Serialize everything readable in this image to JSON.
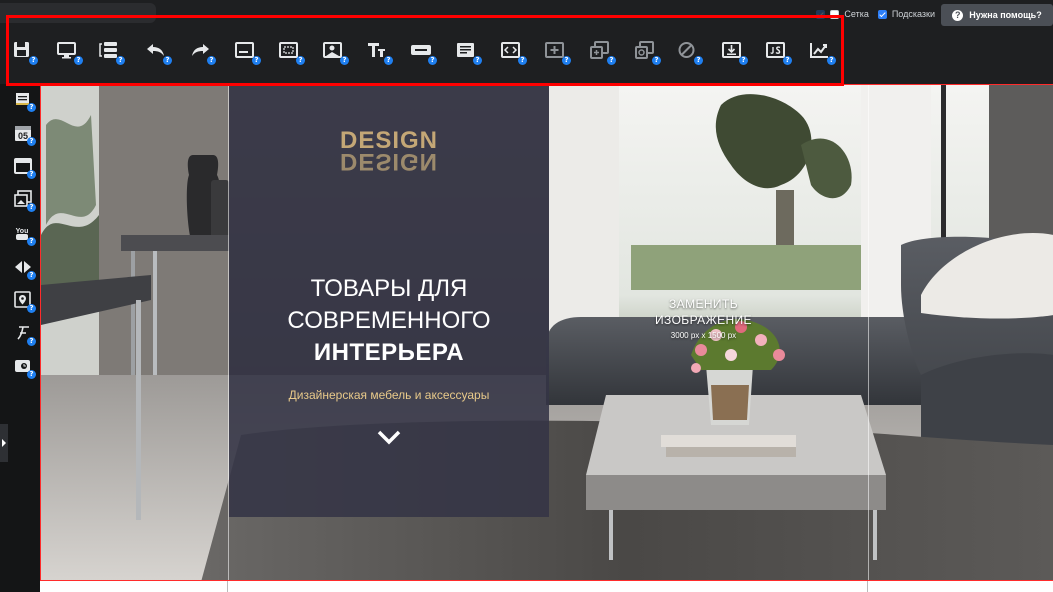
{
  "topbar": {
    "grid_label": "Сетка",
    "hints_label": "Подсказки",
    "help_button": "Нужна помощь?"
  },
  "toolbar": {
    "badge": "?",
    "buttons": [
      {
        "icon": "save-icon"
      },
      {
        "icon": "desktop-preview-icon"
      },
      {
        "icon": "layers-icon"
      },
      {
        "icon": "undo-icon"
      },
      {
        "icon": "redo-icon"
      },
      {
        "icon": "block-icon"
      },
      {
        "icon": "frame-icon"
      },
      {
        "icon": "image-icon"
      },
      {
        "icon": "text-icon"
      },
      {
        "icon": "button-element-icon"
      },
      {
        "icon": "paragraph-icon"
      },
      {
        "icon": "html-code-icon"
      },
      {
        "icon": "add-block-icon"
      },
      {
        "icon": "duplicate-icon"
      },
      {
        "icon": "screenshot-icon"
      },
      {
        "icon": "disable-icon"
      },
      {
        "icon": "download-icon"
      },
      {
        "icon": "js-icon"
      },
      {
        "icon": "analytics-icon"
      }
    ]
  },
  "sidebar": {
    "items": [
      {
        "icon": "note-icon"
      },
      {
        "icon": "calendar-icon",
        "text": "05"
      },
      {
        "icon": "window-icon"
      },
      {
        "icon": "gallery-icon"
      },
      {
        "icon": "youtube-icon",
        "text": "You"
      },
      {
        "icon": "slider-arrows-icon"
      },
      {
        "icon": "map-pin-icon"
      },
      {
        "icon": "font-icon"
      },
      {
        "icon": "toggle-icon"
      }
    ]
  },
  "hero": {
    "logo": "DESIGN",
    "line1": "ТОВАРЫ ДЛЯ",
    "line2": "СОВРЕМЕННОГО",
    "line3": "ИНТЕРЬЕРА",
    "subtitle": "Дизайнерская мебель и аксессуары"
  },
  "replace": {
    "line1": "ЗАМЕНИТЬ",
    "line2": "ИЗОБРАЖЕНИЕ",
    "size": "3000 px x 1500 px"
  },
  "colors": {
    "accent": "#1f7ff0",
    "highlight": "#ff0000",
    "panel": "#343446",
    "logo": "#c4a776"
  }
}
